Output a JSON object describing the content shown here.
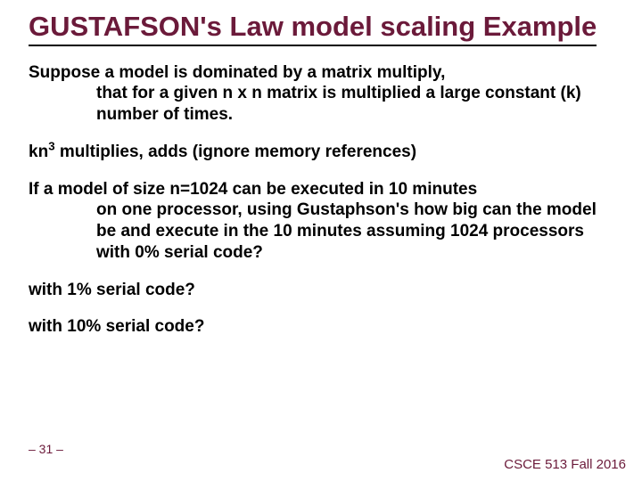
{
  "title": "GUSTAFSON's Law model scaling Example",
  "p1_lead": "Suppose a model is dominated by a matrix multiply,",
  "p1_rest": "that for a given n x n matrix  is multiplied a large constant (k) number of times.",
  "p2_pre": "kn",
  "p2_sup": "3",
  "p2_post": " multiplies, adds (ignore memory references)",
  "p3_lead": "If a model of size n=1024 can be executed in 10 minutes",
  "p3_rest": "on one processor, using Gustaphson's how big can the model be and execute in the 10 minutes assuming 1024 processors with 0% serial code?",
  "p4": "with 1% serial code?",
  "p5": "with 10% serial code?",
  "footer_left": "– 31 –",
  "footer_right": "CSCE 513 Fall 2016"
}
